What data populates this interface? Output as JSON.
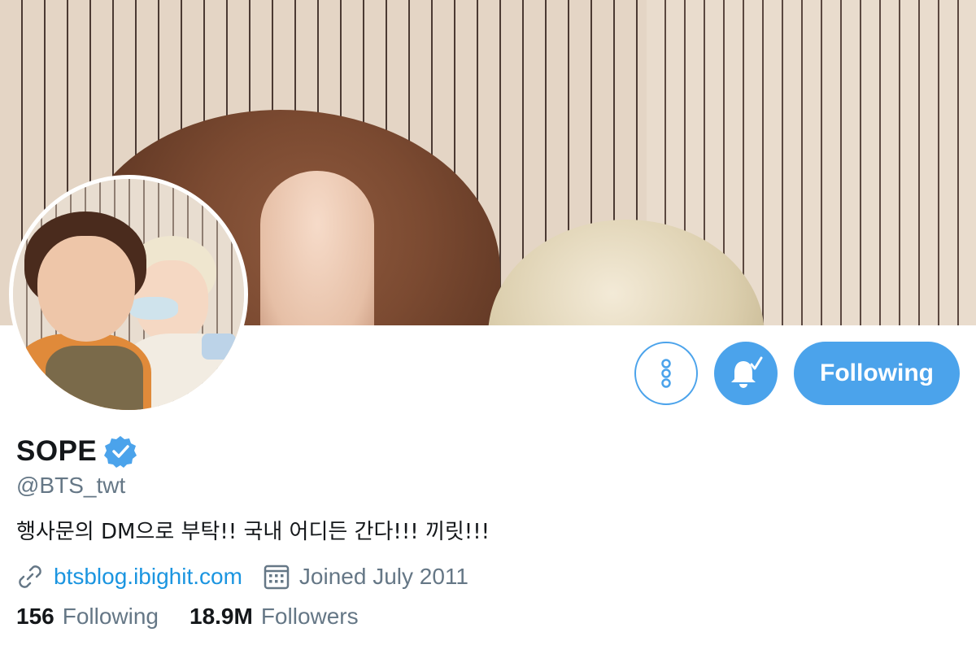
{
  "banner": {
    "alt_kind": "header-photo"
  },
  "profile": {
    "display_name": "SOPE",
    "verified": true,
    "handle": "@BTS_twt",
    "bio": "행사문의 DM으로 부탁!! 국내 어디든 간다!!! 끼릿!!!",
    "website": "btsblog.ibighit.com",
    "joined": "Joined July 2011"
  },
  "actions": {
    "more_icon": "more-vertical-icon",
    "notify_icon": "bell-check-icon",
    "follow_label": "Following"
  },
  "stats": {
    "following_count": "156",
    "following_label": "Following",
    "followers_count": "18.9M",
    "followers_label": "Followers"
  },
  "colors": {
    "accent": "#4ba3eb",
    "link": "#1b95e0",
    "muted": "#657786",
    "text": "#14171a"
  }
}
